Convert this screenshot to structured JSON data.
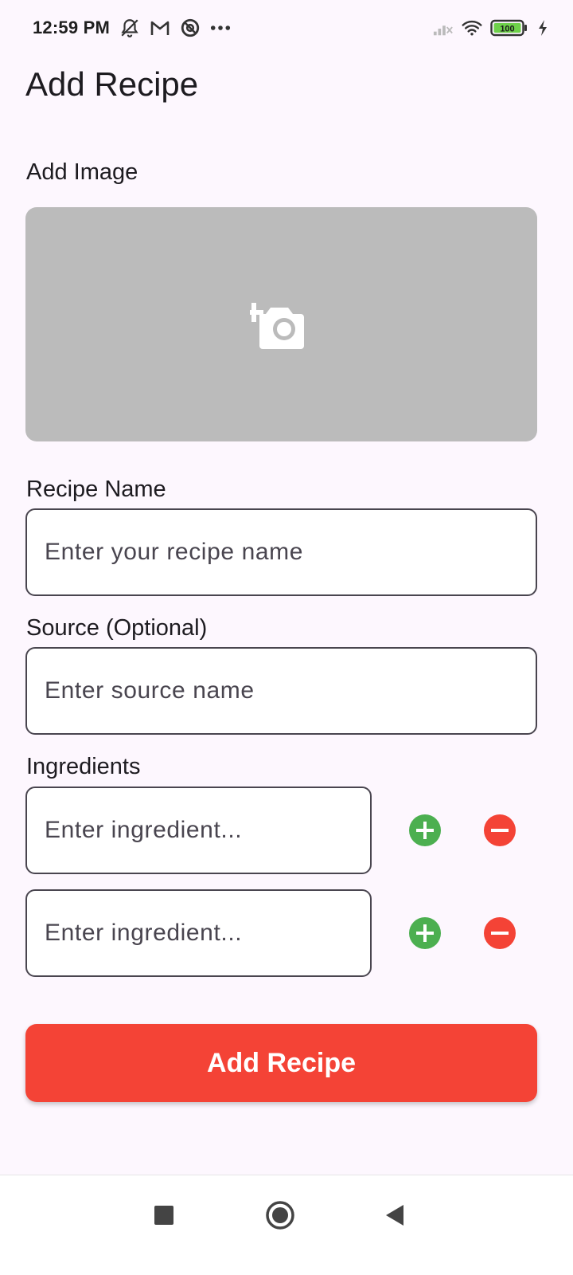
{
  "status_bar": {
    "time": "12:59 PM",
    "left_icons": [
      "notifications-off-icon",
      "gmail-icon",
      "at-sign-icon",
      "more-dots-icon"
    ],
    "right_icons": [
      "signal-no-service-icon",
      "wifi-icon",
      "battery-icon",
      "charging-bolt-icon"
    ],
    "battery_level": "100"
  },
  "app_bar": {
    "title": "Add Recipe"
  },
  "image_section": {
    "label": "Add Image",
    "icon": "add-a-photo-icon",
    "color": "#bbbbbb"
  },
  "recipe_name": {
    "label": "Recipe Name",
    "placeholder": "Enter your recipe name",
    "value": ""
  },
  "source": {
    "label": "Source (Optional)",
    "placeholder": "Enter source name",
    "value": ""
  },
  "ingredients": {
    "label": "Ingredients",
    "items": [
      {
        "placeholder": "Enter ingredient...",
        "value": ""
      },
      {
        "placeholder": "Enter ingredient...",
        "value": ""
      }
    ],
    "add_icon": "add-circle-icon",
    "remove_icon": "remove-circle-icon",
    "add_color": "#4caf50",
    "remove_color": "#f44336"
  },
  "submit": {
    "label": "Add Recipe",
    "color": "#f44336"
  },
  "nav_bar": {
    "icons": [
      "recents-square-icon",
      "home-circle-icon",
      "back-triangle-icon"
    ]
  }
}
